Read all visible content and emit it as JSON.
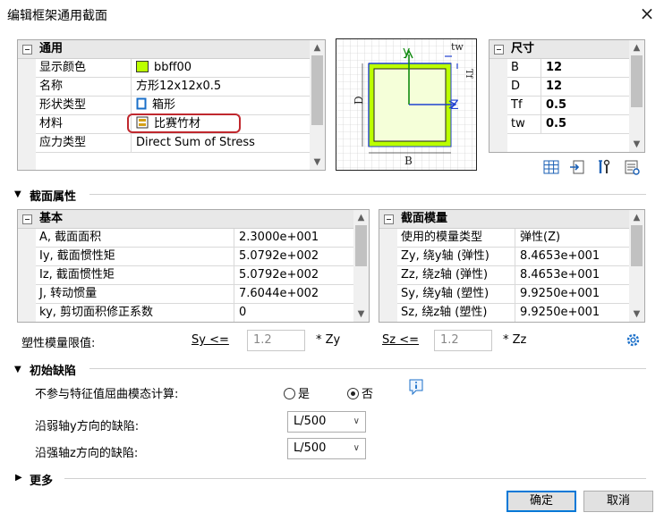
{
  "window": {
    "title": "编辑框架通用截面",
    "close_icon": "×"
  },
  "general_grid": {
    "header": "通用",
    "rows": [
      {
        "label": "显示颜色",
        "value": "bbff00",
        "color": "#bbff00"
      },
      {
        "label": "名称",
        "value": "方形12x12x0.5"
      },
      {
        "label": "形状类型",
        "value": "箱形"
      },
      {
        "label": "材料",
        "value": "比赛竹材"
      },
      {
        "label": "应力类型",
        "value": "Direct Sum of Stress"
      }
    ]
  },
  "diagram": {
    "y_label": "y",
    "z_label": "Z",
    "d_label": "D",
    "b_label": "B",
    "tw_label": "tw",
    "tf_label": "Tf",
    "highlight_color": "#bbff00"
  },
  "dimensions_grid": {
    "header": "尺寸",
    "rows": [
      {
        "label": "B",
        "value": "12"
      },
      {
        "label": "D",
        "value": "12"
      },
      {
        "label": "Tf",
        "value": "0.5"
      },
      {
        "label": "tw",
        "value": "0.5"
      }
    ]
  },
  "section_properties": {
    "title": "截面属性"
  },
  "basic_grid": {
    "header": "基本",
    "rows": [
      {
        "label": "A, 截面面积",
        "value": "2.3000e+001"
      },
      {
        "label": "Iy, 截面惯性矩",
        "value": "5.0792e+002"
      },
      {
        "label": "Iz, 截面惯性矩",
        "value": "5.0792e+002"
      },
      {
        "label": "J, 转动惯量",
        "value": "7.6044e+002"
      },
      {
        "label": "ky, 剪切面积修正系数",
        "value": "0"
      }
    ]
  },
  "modulus_grid": {
    "header": "截面模量",
    "rows": [
      {
        "label": "使用的模量类型",
        "value": "弹性(Z)"
      },
      {
        "label": "Zy, 绕y轴 (弹性)",
        "value": "8.4653e+001"
      },
      {
        "label": "Zz, 绕z轴 (弹性)",
        "value": "8.4653e+001"
      },
      {
        "label": "Sy, 绕y轴 (塑性)",
        "value": "9.9250e+001"
      },
      {
        "label": "Sz, 绕z轴 (塑性)",
        "value": "9.9250e+001"
      }
    ]
  },
  "plastic_limit": {
    "label": "塑性模量限值:",
    "sy_label": "Sy <=",
    "sy_value": "1.2",
    "sy_suffix": "* Zy",
    "sz_label": "Sz <=",
    "sz_value": "1.2",
    "sz_suffix": "* Zz"
  },
  "imperfection": {
    "title": "初始缺陷",
    "exclude_label": "不参与特征值屈曲模态计算:",
    "yes_label": "是",
    "no_label": "否",
    "selected": "否",
    "weak_label": "沿弱轴y方向的缺陷:",
    "weak_value": "L/500",
    "strong_label": "沿强轴z方向的缺陷:",
    "strong_value": "L/500"
  },
  "more": {
    "title": "更多"
  },
  "buttons": {
    "ok": "确定",
    "cancel": "取消"
  }
}
